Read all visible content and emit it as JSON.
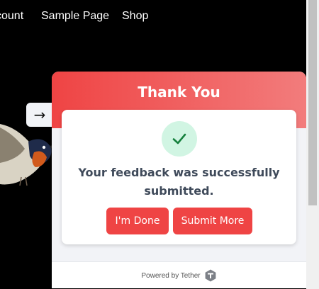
{
  "nav": {
    "items": [
      "count",
      "Sample Page",
      "Shop"
    ]
  },
  "side_tab": {
    "arrow": "→",
    "icon": "arrow-right-icon"
  },
  "widget": {
    "title": "Thank You",
    "message": "Your feedback was successfully submitted.",
    "done_label": "I'm Done",
    "more_label": "Submit More",
    "powered_by": "Powered by Tether",
    "colors": {
      "accent": "#ef4444",
      "check_bg": "#d1f5e3",
      "check": "#15803d"
    }
  }
}
